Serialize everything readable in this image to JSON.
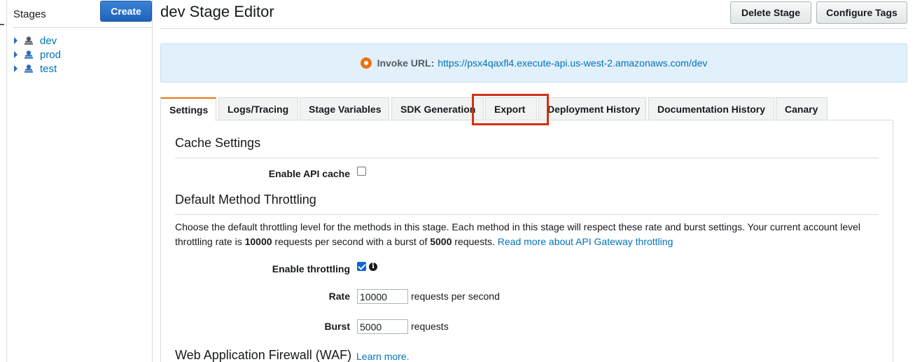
{
  "sidebar": {
    "title": "Stages",
    "create_label": "Create",
    "stages": [
      {
        "label": "dev"
      },
      {
        "label": "prod"
      },
      {
        "label": "test"
      }
    ]
  },
  "header": {
    "title": "dev Stage Editor",
    "delete_label": "Delete Stage",
    "configure_label": "Configure Tags"
  },
  "invoke": {
    "label": "Invoke URL:",
    "url": "https://psx4qaxfl4.execute-api.us-west-2.amazonaws.com/dev"
  },
  "tabs": [
    {
      "label": "Settings",
      "active": true
    },
    {
      "label": "Logs/Tracing"
    },
    {
      "label": "Stage Variables"
    },
    {
      "label": "SDK Generation"
    },
    {
      "label": "Export",
      "highlighted": true
    },
    {
      "label": "Deployment History"
    },
    {
      "label": "Documentation History"
    },
    {
      "label": "Canary"
    }
  ],
  "settings": {
    "cache_title": "Cache Settings",
    "enable_cache_label": "Enable API cache",
    "enable_cache_checked": false,
    "throttling_title": "Default Method Throttling",
    "desc_part1": "Choose the default throttling level for the methods in this stage. Each method in this stage will respect these rate and burst settings. Your current account level throttling rate is ",
    "desc_rate": "10000",
    "desc_part2": " requests per second with a burst of ",
    "desc_burst": "5000",
    "desc_part3": " requests. ",
    "desc_link": "Read more about API Gateway throttling",
    "enable_throttling_label": "Enable throttling",
    "enable_throttling_checked": true,
    "rate_label": "Rate",
    "rate_value": "10000",
    "rate_unit": "requests per second",
    "burst_label": "Burst",
    "burst_value": "5000",
    "burst_unit": "requests",
    "waf_title": "Web Application Firewall (WAF)",
    "waf_link": "Learn more."
  },
  "colors": {
    "accent_orange": "#ec7211",
    "link_blue": "#0073bb",
    "highlight_red": "#d13212",
    "primary_button": "#1e63b8"
  },
  "icons": {
    "stage": "stage-icon",
    "invoke": "invoke-url-icon",
    "info": "info-icon",
    "caret": "caret-right-icon"
  }
}
